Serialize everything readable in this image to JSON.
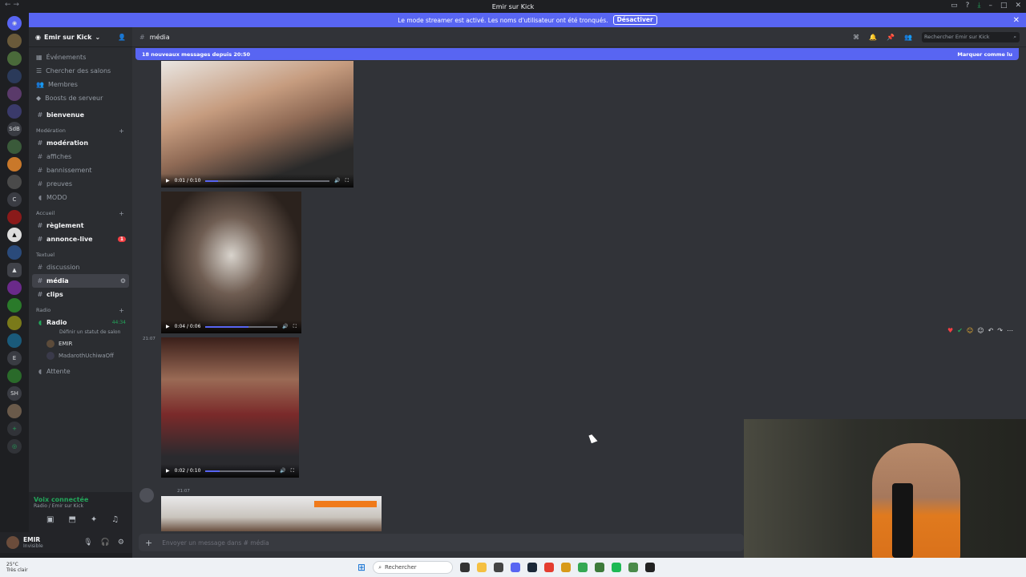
{
  "window": {
    "title": "Emir sur Kick"
  },
  "banner": {
    "text": "Le mode streamer est activé. Les noms d'utilisateur ont été tronqués.",
    "button": "Désactiver"
  },
  "guild_rail": {
    "labels": [
      "SdB",
      "C",
      "E",
      "SH"
    ]
  },
  "server": {
    "name": "Emir sur Kick"
  },
  "nav": [
    {
      "label": "Événements",
      "icon": "calendar-icon"
    },
    {
      "label": "Chercher des salons",
      "icon": "browse-icon"
    },
    {
      "label": "Membres",
      "icon": "members-icon"
    },
    {
      "label": "Boosts de serveur",
      "icon": "boost-icon"
    }
  ],
  "channels": {
    "bienvenue": "bienvenue",
    "cat_moderation": "Modération",
    "moderation": [
      "modération",
      "affiches",
      "bannissement",
      "preuves",
      "MODO"
    ],
    "cat_accueil": "Accueil",
    "accueil": [
      "règlement",
      "annonce-live"
    ],
    "annonce_badge": "1",
    "cat_textuel": "Textuel",
    "textuel": [
      "discussion",
      "média",
      "clips"
    ],
    "cat_radio": "Radio",
    "radio": "Radio",
    "radio_time": "44:34",
    "radio_status": "Définir un statut de salon",
    "voice_users": [
      "EMIR",
      "MadarothUchiwaOff"
    ],
    "attente": "Attente"
  },
  "voice": {
    "status": "Voix connectée",
    "channel": "Radio / Emir sur Kick"
  },
  "user": {
    "name": "EMIR",
    "status": "Invisible"
  },
  "header": {
    "channel": "média",
    "search_placeholder": "Rechercher Emir sur Kick"
  },
  "new_messages": {
    "text": "18 nouveaux messages depuis 20:50",
    "action": "Marquer comme lu"
  },
  "videos": [
    {
      "time": "0:01 / 0:10",
      "progress": 0.1
    },
    {
      "time": "0:04 / 0:06",
      "progress": 0.6
    },
    {
      "time": "0:02 / 0:10",
      "progress": 0.2
    }
  ],
  "timestamps": {
    "t1": "21:07",
    "t2": "21:07"
  },
  "composer": {
    "placeholder": "Envoyer un message dans # média"
  },
  "taskbar": {
    "temp": "25°C",
    "weather": "Très clair",
    "search": "Rechercher"
  },
  "colors": {
    "accent": "#5865f2",
    "online": "#23a55a",
    "badge": "#f23f43"
  }
}
